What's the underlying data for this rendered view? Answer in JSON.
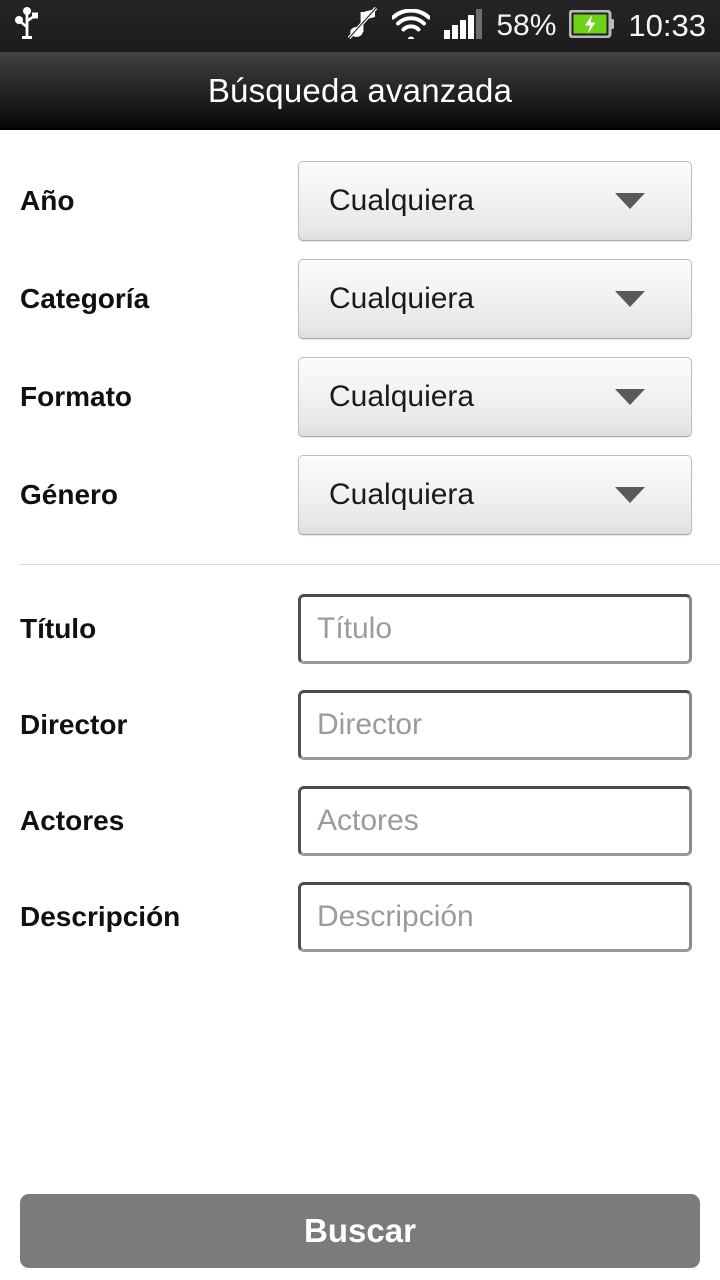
{
  "status_bar": {
    "left_icons": [
      {
        "name": "usb-icon",
        "glyph": "usb"
      }
    ],
    "right_icons": [
      {
        "name": "music-muted-icon",
        "glyph": "music-note-slash"
      },
      {
        "name": "wifi-icon",
        "glyph": "wifi-full"
      },
      {
        "name": "cellular-signal-icon",
        "glyph": "signal-bars",
        "bars_filled": 4,
        "bars_total": 5
      }
    ],
    "battery_percent": "58%",
    "battery_charging": true,
    "battery_color": "#6fd11a",
    "clock": "10:33"
  },
  "title_bar": {
    "title": "Búsqueda avanzada"
  },
  "form": {
    "spinner_rows": [
      {
        "label": "Año",
        "value": "Cualquiera"
      },
      {
        "label": "Categoría",
        "value": "Cualquiera"
      },
      {
        "label": "Formato",
        "value": "Cualquiera"
      },
      {
        "label": "Género",
        "value": "Cualquiera"
      }
    ],
    "input_rows": [
      {
        "label": "Título",
        "value": "",
        "placeholder": "Título"
      },
      {
        "label": "Director",
        "value": "",
        "placeholder": "Director"
      },
      {
        "label": "Actores",
        "value": "",
        "placeholder": "Actores"
      },
      {
        "label": "Descripción",
        "value": "",
        "placeholder": "Descripción"
      }
    ]
  },
  "footer": {
    "submit_label": "Buscar",
    "submit_color": "#7b7b7b"
  }
}
